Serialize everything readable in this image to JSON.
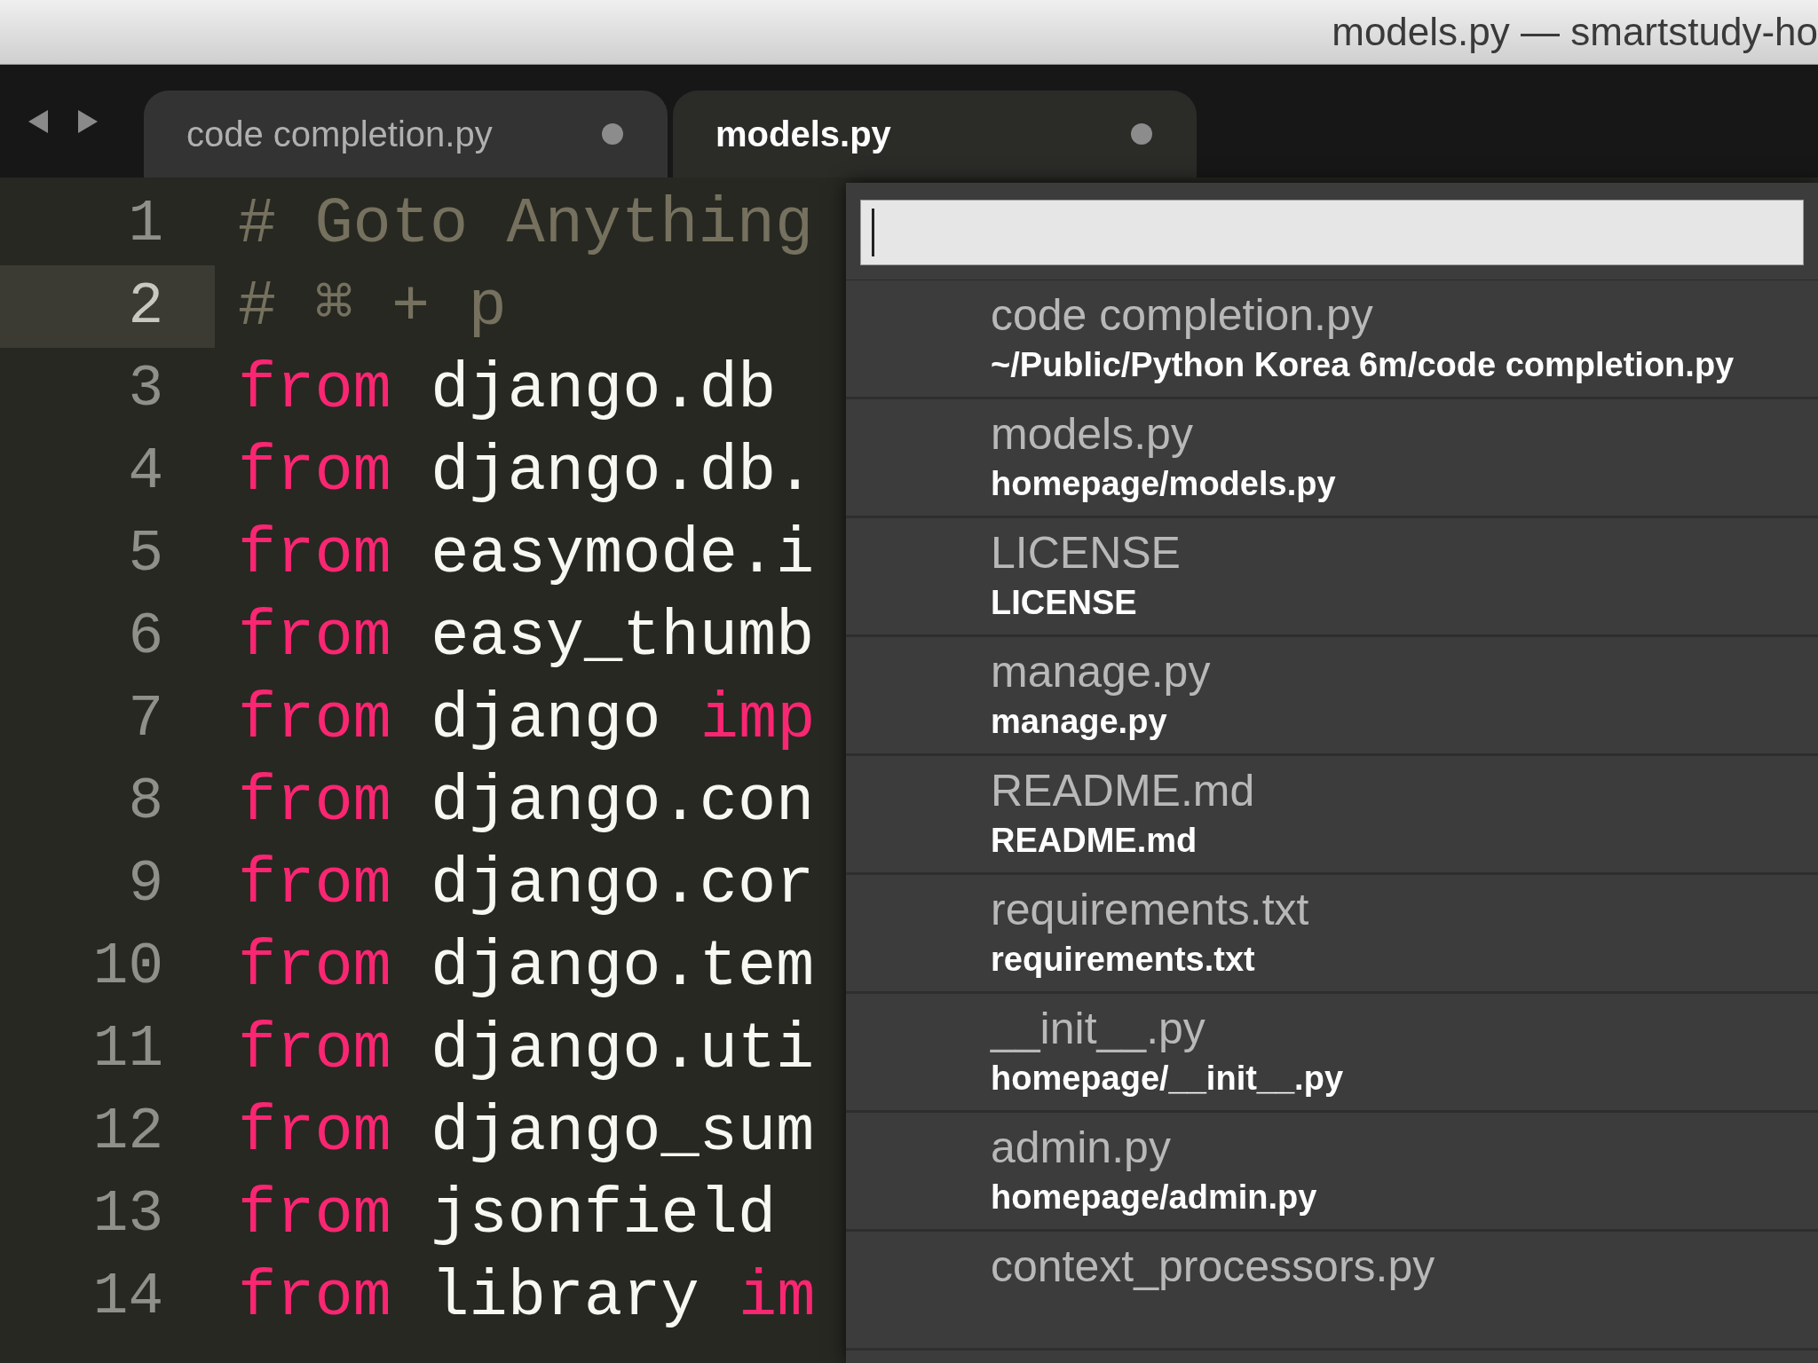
{
  "window": {
    "title": "models.py — smartstudy-ho"
  },
  "tabs": [
    {
      "label": "code completion.py",
      "selected": false,
      "modified": true
    },
    {
      "label": "models.py",
      "selected": true,
      "modified": true
    }
  ],
  "editor": {
    "lines": [
      {
        "number": "1",
        "current": false,
        "tokens": [
          {
            "kind": "comment",
            "text": "# Goto Anything"
          }
        ]
      },
      {
        "number": "2",
        "current": true,
        "tokens": [
          {
            "kind": "comment",
            "text": "# ⌘ + p"
          }
        ]
      },
      {
        "number": "3",
        "current": false,
        "tokens": [
          {
            "kind": "keyword",
            "text": "from"
          },
          {
            "kind": "name",
            "text": "django.db"
          }
        ]
      },
      {
        "number": "4",
        "current": false,
        "tokens": [
          {
            "kind": "keyword",
            "text": "from"
          },
          {
            "kind": "name",
            "text": "django.db."
          }
        ]
      },
      {
        "number": "5",
        "current": false,
        "tokens": [
          {
            "kind": "keyword",
            "text": "from"
          },
          {
            "kind": "name",
            "text": "easymode.i"
          }
        ]
      },
      {
        "number": "6",
        "current": false,
        "tokens": [
          {
            "kind": "keyword",
            "text": "from"
          },
          {
            "kind": "name",
            "text": "easy_thumb"
          }
        ]
      },
      {
        "number": "7",
        "current": false,
        "tokens": [
          {
            "kind": "keyword",
            "text": "from"
          },
          {
            "kind": "name",
            "text": "django"
          },
          {
            "kind": "keyword",
            "text": "imp"
          }
        ]
      },
      {
        "number": "8",
        "current": false,
        "tokens": [
          {
            "kind": "keyword",
            "text": "from"
          },
          {
            "kind": "name",
            "text": "django.con"
          }
        ]
      },
      {
        "number": "9",
        "current": false,
        "tokens": [
          {
            "kind": "keyword",
            "text": "from"
          },
          {
            "kind": "name",
            "text": "django.cor"
          }
        ]
      },
      {
        "number": "10",
        "current": false,
        "tokens": [
          {
            "kind": "keyword",
            "text": "from"
          },
          {
            "kind": "name",
            "text": "django.tem"
          }
        ]
      },
      {
        "number": "11",
        "current": false,
        "tokens": [
          {
            "kind": "keyword",
            "text": "from"
          },
          {
            "kind": "name",
            "text": "django.uti"
          }
        ]
      },
      {
        "number": "12",
        "current": false,
        "tokens": [
          {
            "kind": "keyword",
            "text": "from"
          },
          {
            "kind": "name",
            "text": "django_sum"
          }
        ]
      },
      {
        "number": "13",
        "current": false,
        "tokens": [
          {
            "kind": "keyword",
            "text": "from"
          },
          {
            "kind": "name",
            "text": "jsonfield"
          }
        ]
      },
      {
        "number": "14",
        "current": false,
        "tokens": [
          {
            "kind": "keyword",
            "text": "from"
          },
          {
            "kind": "name",
            "text": "library"
          },
          {
            "kind": "keyword",
            "text": "im"
          }
        ]
      }
    ]
  },
  "goto_panel": {
    "results": [
      {
        "name": "code completion.py",
        "path": "~/Public/Python Korea 6m/code completion.py"
      },
      {
        "name": "models.py",
        "path": "homepage/models.py"
      },
      {
        "name": "LICENSE",
        "path": "LICENSE"
      },
      {
        "name": "manage.py",
        "path": "manage.py"
      },
      {
        "name": "README.md",
        "path": "README.md"
      },
      {
        "name": "requirements.txt",
        "path": "requirements.txt"
      },
      {
        "name": "__init__.py",
        "path": "homepage/__init__.py"
      },
      {
        "name": "admin.py",
        "path": "homepage/admin.py"
      },
      {
        "name": "context_processors.py"
      }
    ]
  }
}
